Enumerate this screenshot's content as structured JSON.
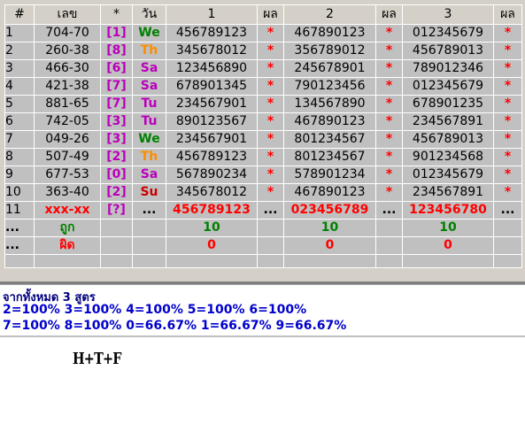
{
  "headers": [
    "#",
    "เลข",
    "*",
    "วัน",
    "1",
    "ผล",
    "2",
    "ผล",
    "3",
    "ผล"
  ],
  "colors": {
    "star": "#ff0000",
    "bracket": "#bb00bb",
    "day_We": "#008000",
    "day_Th": "#ff8c00",
    "day_Sa": "#bb00bb",
    "day_Tu": "#bb00bb",
    "day_Su": "#cc0000",
    "correct": "#008000",
    "wrong": "#ff0000",
    "summary": "#0000cc"
  },
  "rows": [
    {
      "num": "1",
      "lekh": "704-70",
      "bracket": "[1]",
      "day": "We",
      "s1": "456789123",
      "r1": "*",
      "s2": "467890123",
      "r2": "*",
      "s3": "012345679",
      "r3": "*"
    },
    {
      "num": "2",
      "lekh": "260-38",
      "bracket": "[8]",
      "day": "Th",
      "s1": "345678012",
      "r1": "*",
      "s2": "356789012",
      "r2": "*",
      "s3": "456789013",
      "r3": "*"
    },
    {
      "num": "3",
      "lekh": "466-30",
      "bracket": "[6]",
      "day": "Sa",
      "s1": "123456890",
      "r1": "*",
      "s2": "245678901",
      "r2": "*",
      "s3": "789012346",
      "r3": "*"
    },
    {
      "num": "4",
      "lekh": "421-38",
      "bracket": "[7]",
      "day": "Sa",
      "s1": "678901345",
      "r1": "*",
      "s2": "790123456",
      "r2": "*",
      "s3": "012345679",
      "r3": "*"
    },
    {
      "num": "5",
      "lekh": "881-65",
      "bracket": "[7]",
      "day": "Tu",
      "s1": "234567901",
      "r1": "*",
      "s2": "134567890",
      "r2": "*",
      "s3": "678901235",
      "r3": "*"
    },
    {
      "num": "6",
      "lekh": "742-05",
      "bracket": "[3]",
      "day": "Tu",
      "s1": "890123567",
      "r1": "*",
      "s2": "467890123",
      "r2": "*",
      "s3": "234567891",
      "r3": "*"
    },
    {
      "num": "7",
      "lekh": "049-26",
      "bracket": "[3]",
      "day": "We",
      "s1": "234567901",
      "r1": "*",
      "s2": "801234567",
      "r2": "*",
      "s3": "456789013",
      "r3": "*"
    },
    {
      "num": "8",
      "lekh": "507-49",
      "bracket": "[2]",
      "day": "Th",
      "s1": "456789123",
      "r1": "*",
      "s2": "801234567",
      "r2": "*",
      "s3": "901234568",
      "r3": "*"
    },
    {
      "num": "9",
      "lekh": "677-53",
      "bracket": "[0]",
      "day": "Sa",
      "s1": "567890234",
      "r1": "*",
      "s2": "578901234",
      "r2": "*",
      "s3": "012345679",
      "r3": "*"
    },
    {
      "num": "10",
      "lekh": "363-40",
      "bracket": "[2]",
      "day": "Su",
      "s1": "345678012",
      "r1": "*",
      "s2": "467890123",
      "r2": "*",
      "s3": "234567891",
      "r3": "*"
    }
  ],
  "pending": {
    "num": "11",
    "lekh": "xxx-xx",
    "bracket": "[?]",
    "dots": "...",
    "s1": "456789123",
    "s2": "023456789",
    "s3": "123456780"
  },
  "correct_row": {
    "num": "...",
    "label": "ถูก",
    "v1": "10",
    "v2": "10",
    "v3": "10"
  },
  "wrong_row": {
    "num": "...",
    "label": "ผิด",
    "v1": "0",
    "v2": "0",
    "v3": "0"
  },
  "summary": {
    "line1": "จากทั้งหมด 3 สูตร",
    "line2": "2=100% 3=100% 4=100% 5=100% 6=100%",
    "line3": "7=100% 8=100% 0=66.67% 1=66.67% 9=66.67%"
  },
  "signature": "H+T+F"
}
